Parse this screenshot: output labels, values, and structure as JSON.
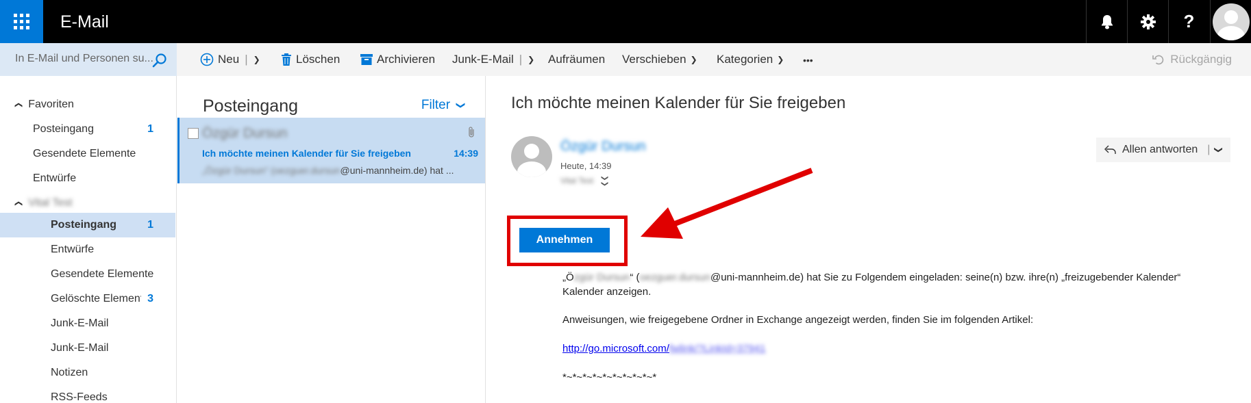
{
  "app": {
    "title": "E-Mail",
    "colors": {
      "accent": "#0078d7",
      "topbar": "#000000",
      "highlight": "#e00000"
    }
  },
  "topbar_icons": [
    "bell-icon",
    "gear-icon",
    "help-icon",
    "avatar"
  ],
  "search": {
    "placeholder": "In E-Mail und Personen su..."
  },
  "toolbar": {
    "new_label": "Neu",
    "delete_label": "Löschen",
    "archive_label": "Archivieren",
    "junk_label": "Junk-E-Mail",
    "sweep_label": "Aufräumen",
    "move_label": "Verschieben",
    "categories_label": "Kategorien",
    "more_label": "•••",
    "undo_label": "Rückgängig"
  },
  "nav": {
    "favorites_label": "Favoriten",
    "favorites": [
      {
        "label": "Posteingang",
        "count": "1"
      },
      {
        "label": "Gesendete Elemente",
        "count": ""
      },
      {
        "label": "Entwürfe",
        "count": ""
      }
    ],
    "account_label": "Vital Test",
    "folders": [
      {
        "label": "Posteingang",
        "count": "1"
      },
      {
        "label": "Entwürfe",
        "count": ""
      },
      {
        "label": "Gesendete Elemente",
        "count": ""
      },
      {
        "label": "Gelöschte Elemente",
        "count": "3"
      },
      {
        "label": "Junk-E-Mail",
        "count": ""
      },
      {
        "label": "Junk-E-Mail",
        "count": ""
      },
      {
        "label": "Notizen",
        "count": ""
      },
      {
        "label": "RSS-Feeds",
        "count": ""
      }
    ]
  },
  "message_list": {
    "title": "Posteingang",
    "filter_label": "Filter",
    "messages": [
      {
        "from": "Özgür Dursun",
        "subject": "Ich möchte meinen Kalender für Sie freigeben",
        "time": "14:39",
        "preview_name": "„Özgür Dursun“",
        "preview_email": "(oezguer.dursun",
        "preview_rest": "@uni-mannheim.de) hat ..."
      }
    ]
  },
  "reading": {
    "subject": "Ich möchte meinen Kalender für Sie freigeben",
    "sender_name": "Özgür Dursun",
    "date": "Heute, 14:39",
    "to": "Vital Test",
    "reply_all_label": "Allen antworten",
    "accept_label": "Annehmen",
    "body": {
      "line1_a": "„Ö",
      "line1_blur_name": "zgür Dursun",
      "line1_b": "“ (",
      "line1_blur_email": "oezguer.dursun",
      "line1_c": "@uni-mannheim.de) hat Sie zu Folgendem eingeladen: seine(n) bzw. ihre(n) „freizugebender Kalender“",
      "line2": "Kalender anzeigen.",
      "line3": "Anweisungen, wie freigegebene Ordner in Exchange angezeigt werden, finden Sie im folgenden Artikel:",
      "link_a": "http://go.microsoft.com/",
      "link_blur": "fwlink/?LinkId=37941",
      "line5": "*~*~*~*~*~*~*~*~*~*"
    }
  }
}
